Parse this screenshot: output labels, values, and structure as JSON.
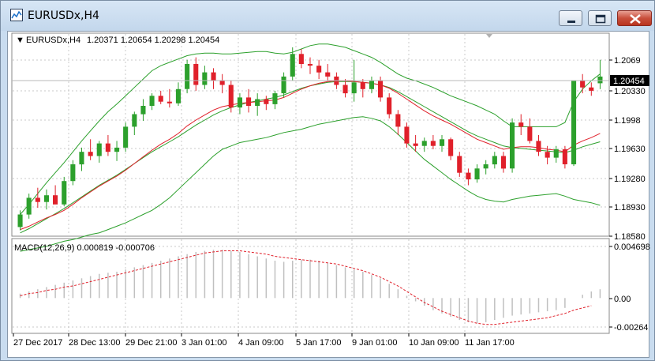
{
  "window": {
    "title": "EURUSDx,H4",
    "min_icon": "minimize-icon",
    "max_icon": "maximize-icon",
    "close_icon": "close-icon"
  },
  "chart_header": {
    "symbol": "EURUSDx,H4",
    "values": "1.20371 1.20654 1.20298 1.20454",
    "arrow": "▼"
  },
  "price_axis": {
    "ticks": [
      "1.2069",
      "1.20330",
      "1.1998",
      "1.19630",
      "1.19280",
      "1.18930",
      "1.18580"
    ],
    "current_price": "1.20454"
  },
  "macd": {
    "label": "MACD(12,26,9) 0.000819 -0.000706",
    "ticks": [
      "0.004698",
      "0.00",
      "-0.00264"
    ]
  },
  "time_axis": {
    "labels": [
      "27 Dec 2017",
      "28 Dec 13:00",
      "29 Dec 21:00",
      "3 Jan 01:00",
      "4 Jan 09:00",
      "5 Jan 17:00",
      "9 Jan 01:00",
      "10 Jan 09:00",
      "11 Jan 17:00"
    ]
  },
  "colors": {
    "bull": "#2ca02c",
    "bear": "#e0202a",
    "ma": "#e0202a",
    "band": "#2ca02c",
    "histogram": "#c0c0c0",
    "signal": "#e0202a",
    "grid": "#c8c8c8"
  },
  "chart_data": {
    "type": "candlestick",
    "symbol": "EURUSDx",
    "timeframe": "H4",
    "ylim": [
      1.1855,
      1.2078
    ],
    "candles": [
      [
        1.1865,
        1.1885,
        1.1861,
        1.188
      ],
      [
        1.188,
        1.1905,
        1.1875,
        1.19
      ],
      [
        1.19,
        1.1912,
        1.1888,
        1.1895
      ],
      [
        1.1895,
        1.191,
        1.1886,
        1.1903
      ],
      [
        1.1903,
        1.1915,
        1.1895,
        1.1892
      ],
      [
        1.1892,
        1.1925,
        1.189,
        1.192
      ],
      [
        1.192,
        1.1945,
        1.1915,
        1.194
      ],
      [
        1.194,
        1.196,
        1.1932,
        1.1955
      ],
      [
        1.1955,
        1.197,
        1.1945,
        1.195
      ],
      [
        1.195,
        1.1968,
        1.1942,
        1.1965
      ],
      [
        1.1965,
        1.1975,
        1.195,
        1.1955
      ],
      [
        1.1955,
        1.1968,
        1.1944,
        1.196
      ],
      [
        1.196,
        1.199,
        1.1955,
        1.1985
      ],
      [
        1.1985,
        1.2003,
        1.1975,
        1.2
      ],
      [
        1.2,
        1.2018,
        1.1992,
        1.201
      ],
      [
        1.201,
        1.2025,
        1.2005,
        1.2022
      ],
      [
        1.2022,
        1.2028,
        1.2012,
        1.2015
      ],
      [
        1.2015,
        1.203,
        1.2008,
        1.2013
      ],
      [
        1.2013,
        1.2038,
        1.201,
        1.203
      ],
      [
        1.203,
        1.2065,
        1.2025,
        1.206
      ],
      [
        1.206,
        1.2068,
        1.2028,
        1.2035
      ],
      [
        1.2035,
        1.2058,
        1.203,
        1.205
      ],
      [
        1.205,
        1.2055,
        1.203,
        1.204
      ],
      [
        1.204,
        1.2048,
        1.2025,
        1.2035
      ],
      [
        1.2035,
        1.204,
        1.2002,
        1.2008
      ],
      [
        1.2008,
        1.2025,
        1.2,
        1.202
      ],
      [
        1.202,
        1.203,
        1.2002,
        1.201
      ],
      [
        1.201,
        1.2025,
        1.1998,
        1.2018
      ],
      [
        1.2018,
        1.2022,
        1.2005,
        1.2012
      ],
      [
        1.2012,
        1.2028,
        1.2006,
        1.2025
      ],
      [
        1.2025,
        1.205,
        1.202,
        1.2045
      ],
      [
        1.2045,
        1.208,
        1.204,
        1.2072
      ],
      [
        1.2072,
        1.2078,
        1.2055,
        1.206
      ],
      [
        1.206,
        1.2068,
        1.2048,
        1.2058
      ],
      [
        1.2058,
        1.2065,
        1.2042,
        1.205
      ],
      [
        1.205,
        1.206,
        1.204,
        1.2045
      ],
      [
        1.2045,
        1.205,
        1.203,
        1.2035
      ],
      [
        1.2035,
        1.2042,
        1.202,
        1.2025
      ],
      [
        1.2025,
        1.2065,
        1.2015,
        1.2038
      ],
      [
        1.2038,
        1.2042,
        1.202,
        1.203
      ],
      [
        1.203,
        1.2045,
        1.2025,
        1.204
      ],
      [
        1.204,
        1.2045,
        1.2015,
        1.202
      ],
      [
        1.202,
        1.2025,
        1.1995,
        1.2
      ],
      [
        1.2,
        1.2005,
        1.1975,
        1.1985
      ],
      [
        1.1985,
        1.199,
        1.196,
        1.1965
      ],
      [
        1.1965,
        1.1975,
        1.1955,
        1.1962
      ],
      [
        1.1962,
        1.1972,
        1.1955,
        1.1968
      ],
      [
        1.1968,
        1.1975,
        1.1958,
        1.1962
      ],
      [
        1.1962,
        1.1975,
        1.1955,
        1.197
      ],
      [
        1.197,
        1.1972,
        1.1945,
        1.195
      ],
      [
        1.195,
        1.1955,
        1.1925,
        1.193
      ],
      [
        1.193,
        1.1935,
        1.1915,
        1.1922
      ],
      [
        1.1922,
        1.194,
        1.1918,
        1.1935
      ],
      [
        1.1935,
        1.1945,
        1.1928,
        1.194
      ],
      [
        1.194,
        1.1955,
        1.1935,
        1.195
      ],
      [
        1.195,
        1.1955,
        1.193,
        1.1935
      ],
      [
        1.1935,
        1.1995,
        1.193,
        1.199
      ],
      [
        1.199,
        1.2,
        1.1975,
        1.1985
      ],
      [
        1.1985,
        1.1995,
        1.1965,
        1.1968
      ],
      [
        1.1968,
        1.1975,
        1.195,
        1.1955
      ],
      [
        1.1955,
        1.1962,
        1.194,
        1.1948
      ],
      [
        1.1948,
        1.1962,
        1.1942,
        1.1958
      ],
      [
        1.1958,
        1.1962,
        1.1935,
        1.194
      ],
      [
        1.194,
        1.204,
        1.1938,
        1.204
      ],
      [
        1.204,
        1.2048,
        1.2025,
        1.2032
      ],
      [
        1.2032,
        1.2038,
        1.2022,
        1.2028
      ],
      [
        1.2037,
        1.2065,
        1.203,
        1.2045
      ]
    ],
    "ma_fast": [
      1.1862,
      1.1866,
      1.1871,
      1.1876,
      1.188,
      1.1885,
      1.1892,
      1.19,
      1.1907,
      1.1914,
      1.192,
      1.1926,
      1.1933,
      1.1941,
      1.1949,
      1.1957,
      1.1964,
      1.197,
      1.1977,
      1.1986,
      1.1993,
      1.1999,
      1.2005,
      1.2009,
      1.2011,
      1.2013,
      1.2014,
      1.2015,
      1.2016,
      1.2017,
      1.202,
      1.2025,
      1.203,
      1.2034,
      1.2037,
      1.2039,
      1.204,
      1.204,
      1.2039,
      1.2038,
      1.2037,
      1.2035,
      1.2031,
      1.2025,
      1.2018,
      1.2011,
      1.2004,
      1.1998,
      1.1993,
      1.1988,
      1.1982,
      1.1976,
      1.197,
      1.1966,
      1.1962,
      1.1958,
      1.196,
      1.1961,
      1.1961,
      1.196,
      1.1958,
      1.1957,
      1.1955,
      1.1963,
      1.1968,
      1.1972,
      1.1977
    ],
    "band_upper": [
      1.188,
      1.1892,
      1.1905,
      1.1918,
      1.193,
      1.1942,
      1.1955,
      1.1968,
      1.198,
      1.1992,
      1.2003,
      1.2012,
      1.2022,
      1.2032,
      1.2042,
      1.2052,
      1.2058,
      1.2062,
      1.2066,
      1.207,
      1.2072,
      1.2073,
      1.2073,
      1.2072,
      1.2072,
      1.2073,
      1.2074,
      1.2075,
      1.2075,
      1.2073,
      1.2072,
      1.2074,
      1.2078,
      1.2082,
      1.2084,
      1.2084,
      1.2082,
      1.208,
      1.2076,
      1.2072,
      1.2068,
      1.2062,
      1.2055,
      1.2048,
      1.2043,
      1.204,
      1.2036,
      1.2032,
      1.2027,
      1.2022,
      1.2018,
      1.2014,
      1.201,
      1.2005,
      1.2,
      1.1992,
      1.1985,
      1.1985,
      1.1985,
      1.1985,
      1.1985,
      1.1985,
      1.199,
      1.2015,
      1.203,
      1.204,
      1.2048
    ],
    "band_middle": [
      1.1858,
      1.1863,
      1.1869,
      1.1875,
      1.1881,
      1.1887,
      1.1894,
      1.1901,
      1.1908,
      1.1915,
      1.1921,
      1.1927,
      1.1934,
      1.1941,
      1.1948,
      1.1955,
      1.1961,
      1.1967,
      1.1973,
      1.198,
      1.1987,
      1.1993,
      1.1999,
      1.2004,
      1.2008,
      1.2011,
      1.2014,
      1.2016,
      1.2018,
      1.202,
      1.2023,
      1.2027,
      1.2031,
      1.2034,
      1.2036,
      1.2038,
      1.2039,
      1.2039,
      1.2039,
      1.2038,
      1.2037,
      1.2035,
      1.2032,
      1.2027,
      1.2021,
      1.2015,
      1.2009,
      1.2003,
      1.1997,
      1.1991,
      1.1985,
      1.1979,
      1.1974,
      1.197,
      1.1966,
      1.1962,
      1.196,
      1.1959,
      1.1958,
      1.1957,
      1.1956,
      1.1955,
      1.1954,
      1.1957,
      1.1961,
      1.1964,
      1.1967
    ],
    "band_lower": [
      1.1836,
      1.1838,
      1.184,
      1.1842,
      1.1845,
      1.1848,
      1.185,
      1.1853,
      1.1856,
      1.1858,
      1.1862,
      1.1866,
      1.187,
      1.1875,
      1.188,
      1.1885,
      1.1892,
      1.19,
      1.191,
      1.192,
      1.193,
      1.194,
      1.195,
      1.1958,
      1.1962,
      1.1966,
      1.1968,
      1.197,
      1.1972,
      1.1975,
      1.1978,
      1.198,
      1.1982,
      1.1985,
      1.1988,
      1.199,
      1.1992,
      1.1994,
      1.1996,
      1.1997,
      1.1995,
      1.1992,
      1.1985,
      1.1976,
      1.1966,
      1.1956,
      1.1946,
      1.1938,
      1.193,
      1.1922,
      1.1915,
      1.1908,
      1.1902,
      1.1898,
      1.1896,
      1.1895,
      1.1898,
      1.19,
      1.1902,
      1.1903,
      1.1904,
      1.1905,
      1.1902,
      1.1898,
      1.1896,
      1.1894,
      1.1891
    ],
    "macd_ylim": [
      -0.00264,
      0.004698
    ],
    "macd_hist": [
      0.0004,
      0.0006,
      0.0008,
      0.001,
      0.0012,
      0.0014,
      0.0016,
      0.0018,
      0.002,
      0.0022,
      0.0023,
      0.0024,
      0.0026,
      0.0028,
      0.003,
      0.0032,
      0.0034,
      0.0036,
      0.0038,
      0.004,
      0.0042,
      0.0043,
      0.0044,
      0.0044,
      0.0043,
      0.0042,
      0.004,
      0.0038,
      0.0036,
      0.0034,
      0.0033,
      0.0034,
      0.0035,
      0.0035,
      0.0034,
      0.0032,
      0.003,
      0.0028,
      0.0026,
      0.0024,
      0.0021,
      0.0018,
      0.0013,
      0.0008,
      0.0002,
      -0.0003,
      -0.0007,
      -0.0011,
      -0.0014,
      -0.0017,
      -0.002,
      -0.0022,
      -0.0023,
      -0.0022,
      -0.002,
      -0.0018,
      -0.0016,
      -0.0015,
      -0.0014,
      -0.0013,
      -0.0012,
      -0.0011,
      -0.0009,
      0.0,
      0.0003,
      0.0006,
      0.0008
    ],
    "macd_signal": [
      0.0002,
      0.0004,
      0.0005,
      0.0007,
      0.0008,
      0.001,
      0.0011,
      0.0013,
      0.0015,
      0.0017,
      0.0019,
      0.0021,
      0.0023,
      0.0025,
      0.0027,
      0.0029,
      0.0031,
      0.0033,
      0.0035,
      0.0037,
      0.0039,
      0.0041,
      0.0042,
      0.0043,
      0.0043,
      0.0043,
      0.0042,
      0.0041,
      0.004,
      0.0038,
      0.0037,
      0.0036,
      0.0035,
      0.0034,
      0.0033,
      0.0032,
      0.0031,
      0.0029,
      0.0027,
      0.0025,
      0.0022,
      0.0019,
      0.0015,
      0.0011,
      0.0006,
      0.0001,
      -0.0004,
      -0.0008,
      -0.0012,
      -0.0015,
      -0.0018,
      -0.0021,
      -0.0023,
      -0.0024,
      -0.0024,
      -0.0023,
      -0.0022,
      -0.0021,
      -0.002,
      -0.0019,
      -0.0018,
      -0.0016,
      -0.0014,
      -0.0011,
      -0.0009,
      -0.0007
    ]
  }
}
